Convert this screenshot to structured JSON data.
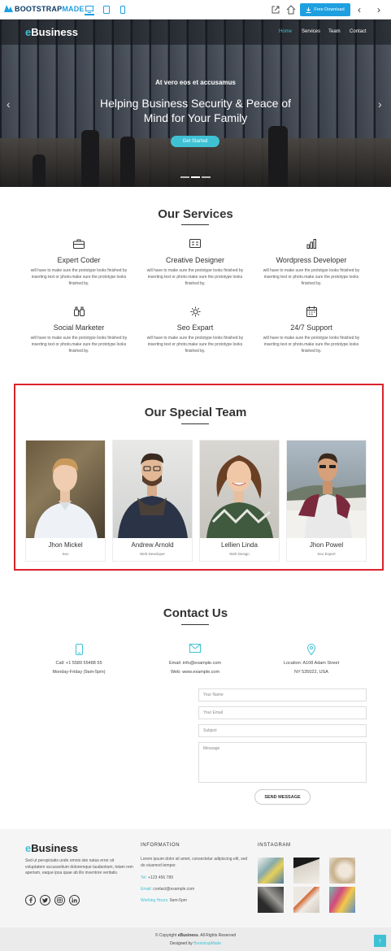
{
  "topbar": {
    "logo_main": "BOOTSTRAP",
    "logo_accent": "MADE",
    "download_label": "Free Download",
    "prev_label": "‹",
    "next_label": "›"
  },
  "nav": {
    "brand_e": "e",
    "brand_rest": "Business",
    "links": [
      "Home",
      "Services",
      "Team",
      "Contact"
    ]
  },
  "hero": {
    "subtitle": "At vero eos et accusamus",
    "title_line1": "Helping Business Security & Peace of",
    "title_line2": "Mind for Your Family",
    "button": "Get Started",
    "prev": "‹",
    "next": "›"
  },
  "services": {
    "title": "Our Services",
    "items": [
      {
        "name": "Expert Coder",
        "desc": "will have to make sure the prototype looks finished by inserting text or photo.make sure the prototype looks finished by.",
        "icon": "briefcase-icon"
      },
      {
        "name": "Creative Designer",
        "desc": "will have to make sure the prototype looks finished by inserting text or photo.make sure the prototype looks finished by.",
        "icon": "card-icon"
      },
      {
        "name": "Wordpress Developer",
        "desc": "will have to make sure the prototype looks finished by inserting text or photo.make sure the prototype looks finished by.",
        "icon": "bar-chart-icon"
      },
      {
        "name": "Social Marketer",
        "desc": "will have to make sure the prototype looks finished by inserting text or photo.make sure the prototype looks finished by.",
        "icon": "binoculars-icon"
      },
      {
        "name": "Seo Expart",
        "desc": "will have to make sure the prototype looks finished by inserting text or photo.make sure the prototype looks finished by.",
        "icon": "sun-icon"
      },
      {
        "name": "24/7 Support",
        "desc": "will have to make sure the prototype looks finished by inserting text or photo.make sure the prototype looks finished by.",
        "icon": "calendar-icon"
      }
    ]
  },
  "team": {
    "title": "Our Special Team",
    "members": [
      {
        "name": "Jhon Mickel",
        "role": "Seo"
      },
      {
        "name": "Andrew Arnold",
        "role": "Web Developer"
      },
      {
        "name": "Lellien Linda",
        "role": "Web Design"
      },
      {
        "name": "Jhon Powel",
        "role": "Seo Expert"
      }
    ]
  },
  "contact": {
    "title": "Contact Us",
    "phone_line1": "Call: +1 5589 55488 55",
    "phone_line2": "Monday-Friday (9am-5pm)",
    "email_line1": "Email: info@example.com",
    "email_line2": "Web: www.example.com",
    "location_line1": "Location: A108 Adam Street",
    "location_line2": "NY 535022, USA",
    "name_placeholder": "Your Name",
    "email_placeholder": "Your Email",
    "subject_placeholder": "Subject",
    "message_placeholder": "Message",
    "send": "SEND MESSAGE"
  },
  "footer": {
    "brand_e": "e",
    "brand_rest": "Business",
    "about": "Sed ut perspiciatis unde omnis iste natus error sit voluptatem accusantium doloremque laudantium, totam rem aperiam, eaque ipsa quae ab illo inventore veritatis.",
    "info_heading": "INFORMATION",
    "info_text": "Lorem ipsum dolor sit amet, consectetur adipiscing elit, sed do eiusmod tempor.",
    "tel_label": "Tel:",
    "tel_value": "+123 456 789",
    "email_label": "Email:",
    "email_value": "contact@example.com",
    "hours_label": "Working Hours:",
    "hours_value": "9am-5pm",
    "instagram_heading": "INSTAGRAM",
    "copyright_prefix": "© Copyright ",
    "copyright_brand": "eBusiness",
    "copyright_suffix": ". All Rights Reserved",
    "designed_prefix": "Designed by ",
    "designed_link": "BootstrapMade",
    "to_top": "↑"
  },
  "colors": {
    "accent": "#3fc1d4",
    "highlight_border": "#d9232d",
    "download_blue": "#1e9fe0"
  }
}
